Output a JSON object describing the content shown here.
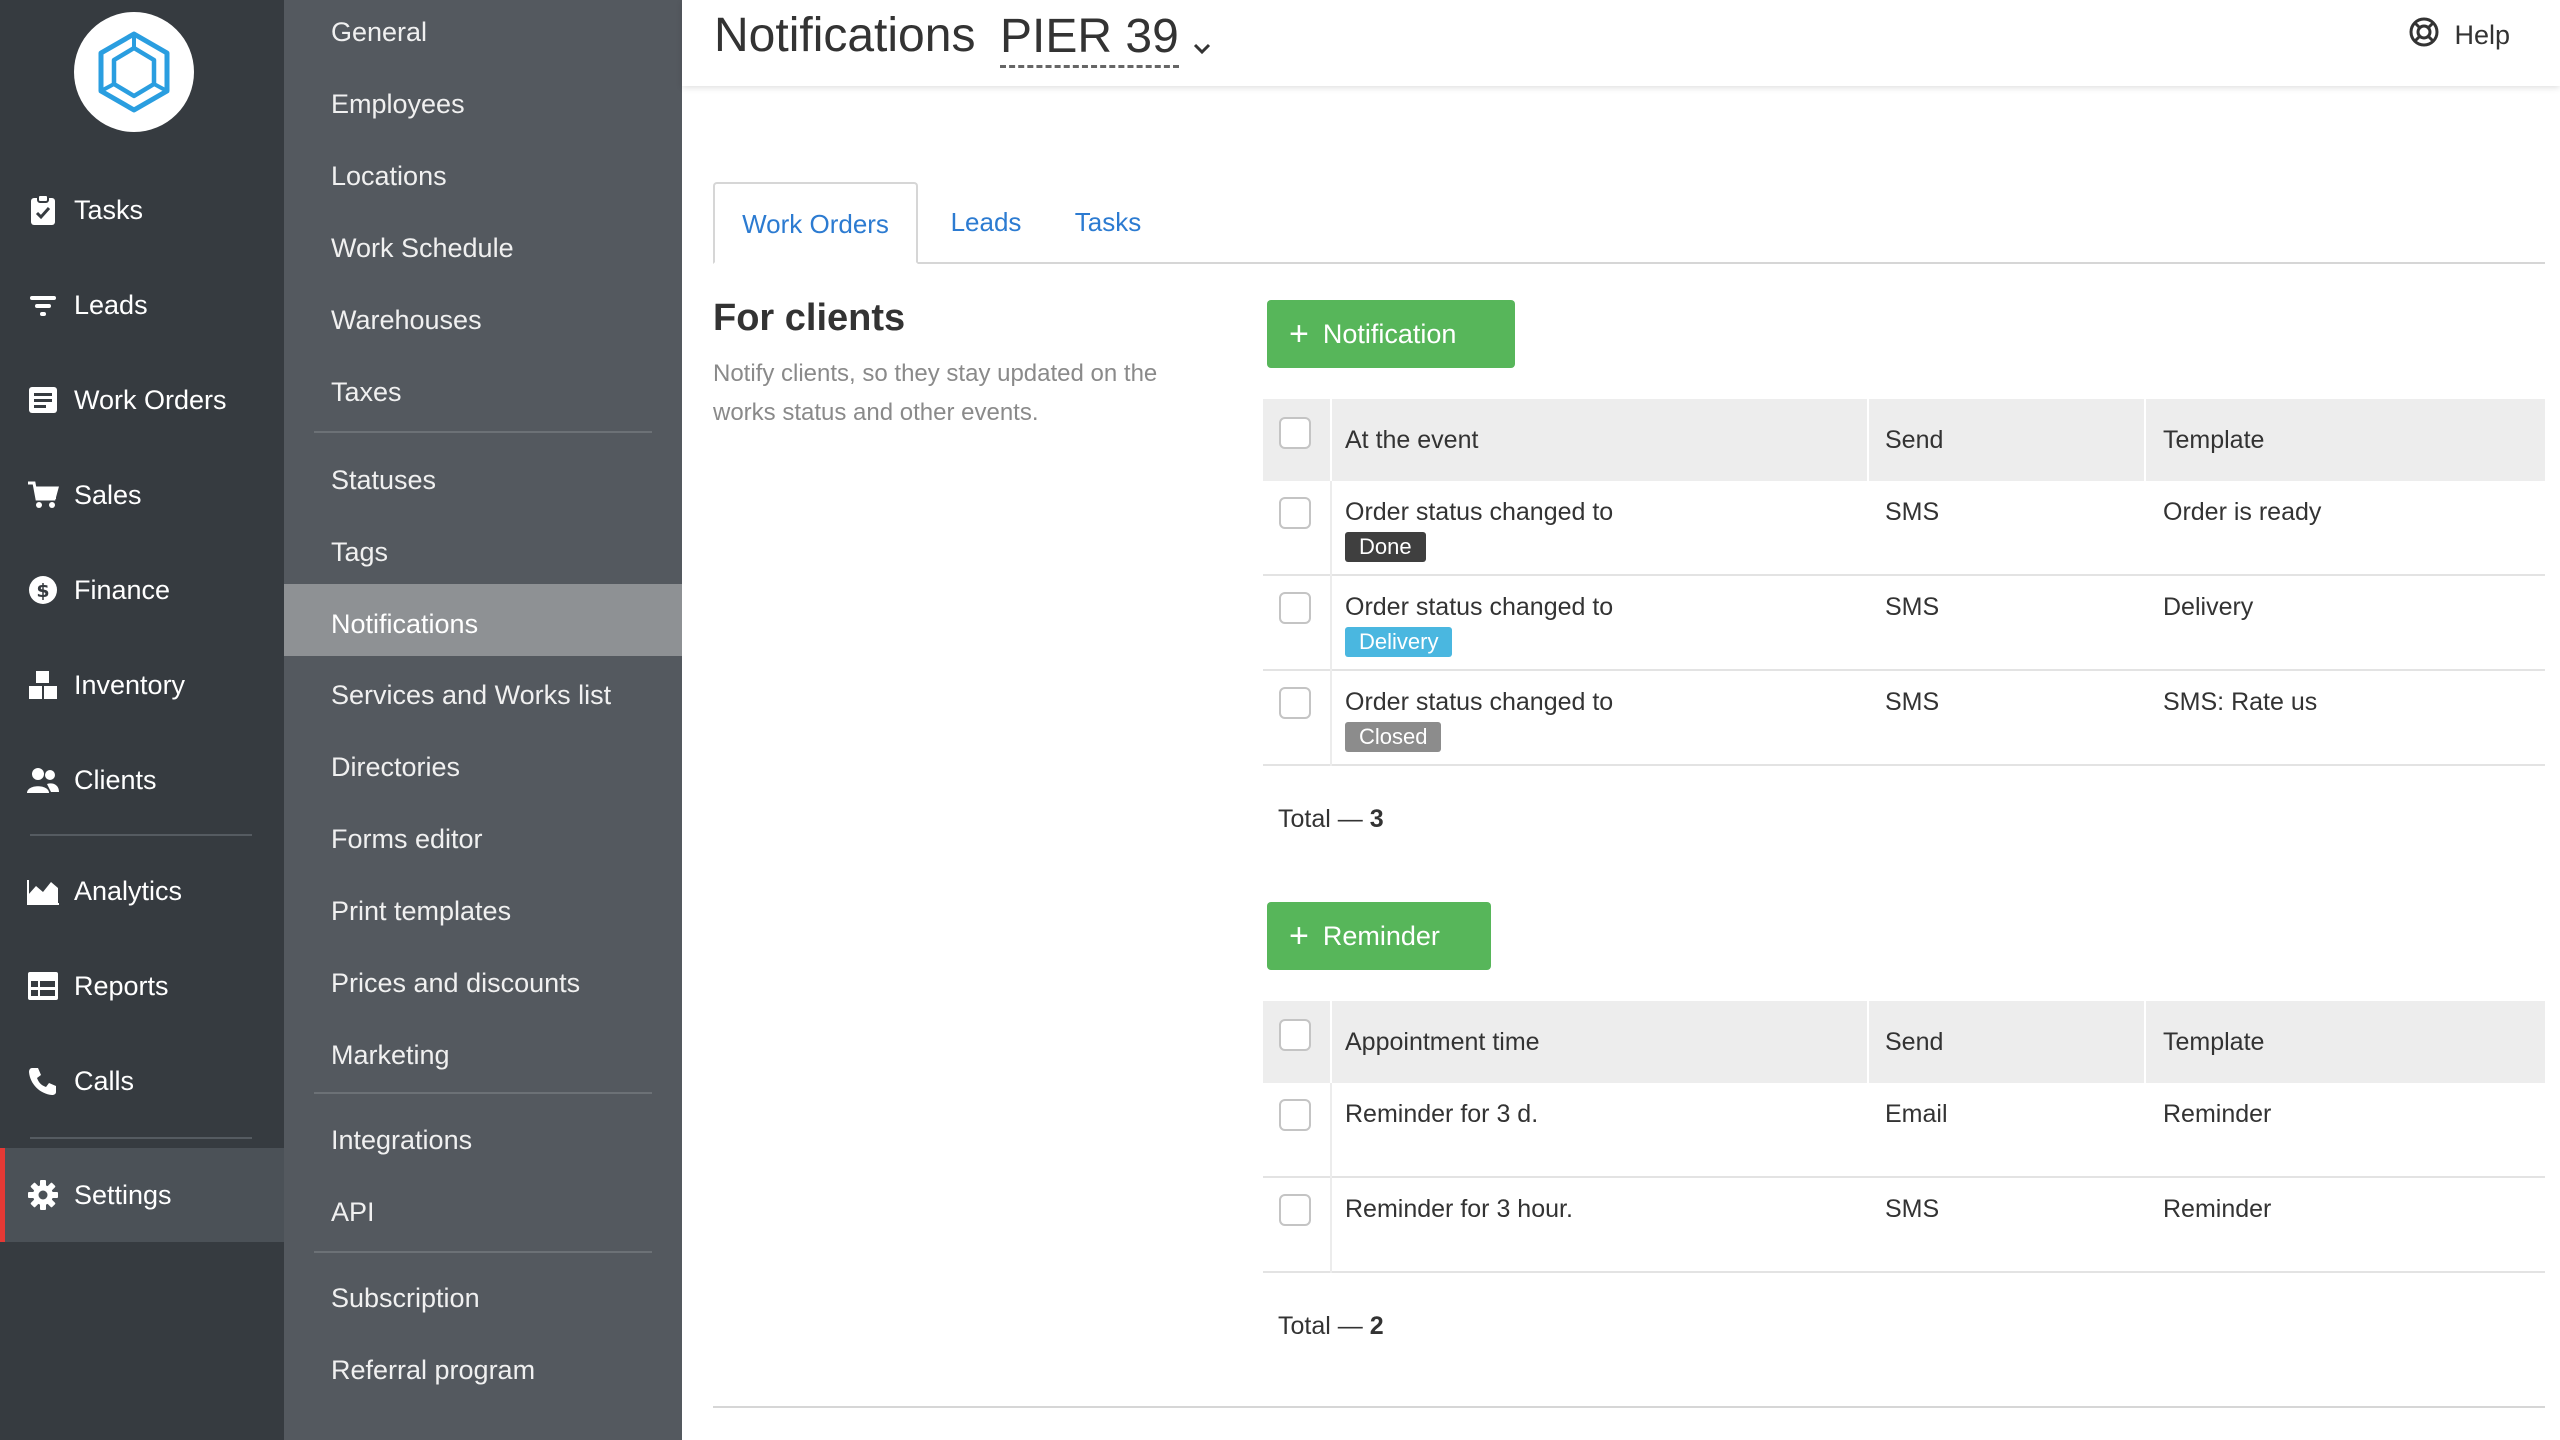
{
  "nav": {
    "items": [
      {
        "label": "Tasks",
        "icon": "clipboard-icon"
      },
      {
        "label": "Leads",
        "icon": "funnel-icon"
      },
      {
        "label": "Work Orders",
        "icon": "work-order-icon"
      },
      {
        "label": "Sales",
        "icon": "cart-icon"
      },
      {
        "label": "Finance",
        "icon": "dollar-icon"
      },
      {
        "label": "Inventory",
        "icon": "boxes-icon"
      },
      {
        "label": "Clients",
        "icon": "users-icon"
      },
      {
        "label": "Analytics",
        "icon": "area-chart-icon"
      },
      {
        "label": "Reports",
        "icon": "table-icon"
      },
      {
        "label": "Calls",
        "icon": "phone-icon"
      },
      {
        "label": "Settings",
        "icon": "gear-icon"
      }
    ],
    "active": "Settings",
    "accent_color": "#e53935"
  },
  "submenu": {
    "items": [
      "General",
      "Employees",
      "Locations",
      "Work Schedule",
      "Warehouses",
      "Taxes",
      "Statuses",
      "Tags",
      "Notifications",
      "Services and Works list",
      "Directories",
      "Forms editor",
      "Print templates",
      "Prices and discounts",
      "Marketing",
      "Integrations",
      "API",
      "Subscription",
      "Referral program"
    ],
    "active": "Notifications"
  },
  "header": {
    "title": "Notifications",
    "location": "PIER 39",
    "help_label": "Help"
  },
  "tabs": [
    {
      "label": "Work Orders",
      "active": true
    },
    {
      "label": "Leads",
      "active": false
    },
    {
      "label": "Tasks",
      "active": false
    }
  ],
  "section": {
    "title": "For clients",
    "description": "Notify clients, so they stay updated on the works status and other events."
  },
  "notifications": {
    "button_label": "Notification",
    "columns": [
      "At the event",
      "Send",
      "Template"
    ],
    "rows": [
      {
        "event": "Order status changed to",
        "status": "Done",
        "status_color": "#3f3f3f",
        "send": "SMS",
        "template": "Order is ready"
      },
      {
        "event": "Order status changed to",
        "status": "Delivery",
        "status_color": "#4ab7e0",
        "send": "SMS",
        "template": "Delivery"
      },
      {
        "event": "Order status changed to",
        "status": "Closed",
        "status_color": "#8c8c8c",
        "send": "SMS",
        "template": "SMS: Rate us"
      }
    ],
    "total_label": "Total —",
    "total_value": "3"
  },
  "reminders": {
    "button_label": "Reminder",
    "columns": [
      "Appointment time",
      "Send",
      "Template"
    ],
    "rows": [
      {
        "time": "Reminder for 3 d.",
        "send": "Email",
        "template": "Reminder"
      },
      {
        "time": "Reminder for 3 hour.",
        "send": "SMS",
        "template": "Reminder"
      }
    ],
    "total_label": "Total —",
    "total_value": "2"
  },
  "colors": {
    "primary_button": "#57b65a",
    "link": "#2c7bd1",
    "nav_bg": "#363b40",
    "submenu_bg": "#54595f"
  }
}
